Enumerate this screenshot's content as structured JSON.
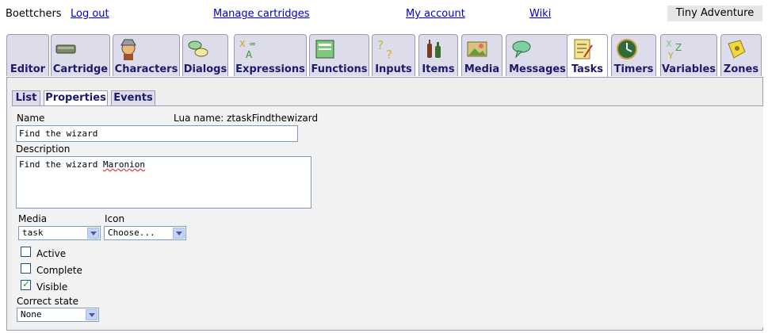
{
  "topbar": {
    "user": "Boettchers",
    "logout": "Log out",
    "manage": "Manage cartridges",
    "account": "My account",
    "wiki": "Wiki",
    "cartridge_title": "Tiny Adventure"
  },
  "tabs": [
    {
      "label": "Editor",
      "icon": "editor-icon"
    },
    {
      "label": "Cartridge",
      "icon": "cartridge-icon"
    },
    {
      "label": "Characters",
      "icon": "characters-icon"
    },
    {
      "label": "Dialogs",
      "icon": "dialogs-icon"
    },
    {
      "label": "Expressions",
      "icon": "expressions-icon"
    },
    {
      "label": "Functions",
      "icon": "functions-icon"
    },
    {
      "label": "Inputs",
      "icon": "inputs-icon"
    },
    {
      "label": "Items",
      "icon": "items-icon"
    },
    {
      "label": "Media",
      "icon": "media-icon"
    },
    {
      "label": "Messages",
      "icon": "messages-icon"
    },
    {
      "label": "Tasks",
      "icon": "tasks-icon",
      "active": true
    },
    {
      "label": "Timers",
      "icon": "timers-icon"
    },
    {
      "label": "Variables",
      "icon": "variables-icon"
    },
    {
      "label": "Zones",
      "icon": "zones-icon"
    }
  ],
  "subtabs": [
    {
      "label": "List"
    },
    {
      "label": "Properties",
      "active": true
    },
    {
      "label": "Events"
    }
  ],
  "form": {
    "name_label": "Name",
    "lua_name": "Lua name: ztaskFindthewizard",
    "name_value": "Find the wizard",
    "description_label": "Description",
    "description_prefix": "Find the wizard ",
    "description_misspelled": "Maronion",
    "media_label": "Media",
    "media_value": "task",
    "icon_label": "Icon",
    "icon_value": "Choose...",
    "active_label": "Active",
    "active_checked": false,
    "complete_label": "Complete",
    "complete_checked": false,
    "visible_label": "Visible",
    "visible_checked": true,
    "correct_state_label": "Correct state",
    "correct_state_value": "None"
  }
}
